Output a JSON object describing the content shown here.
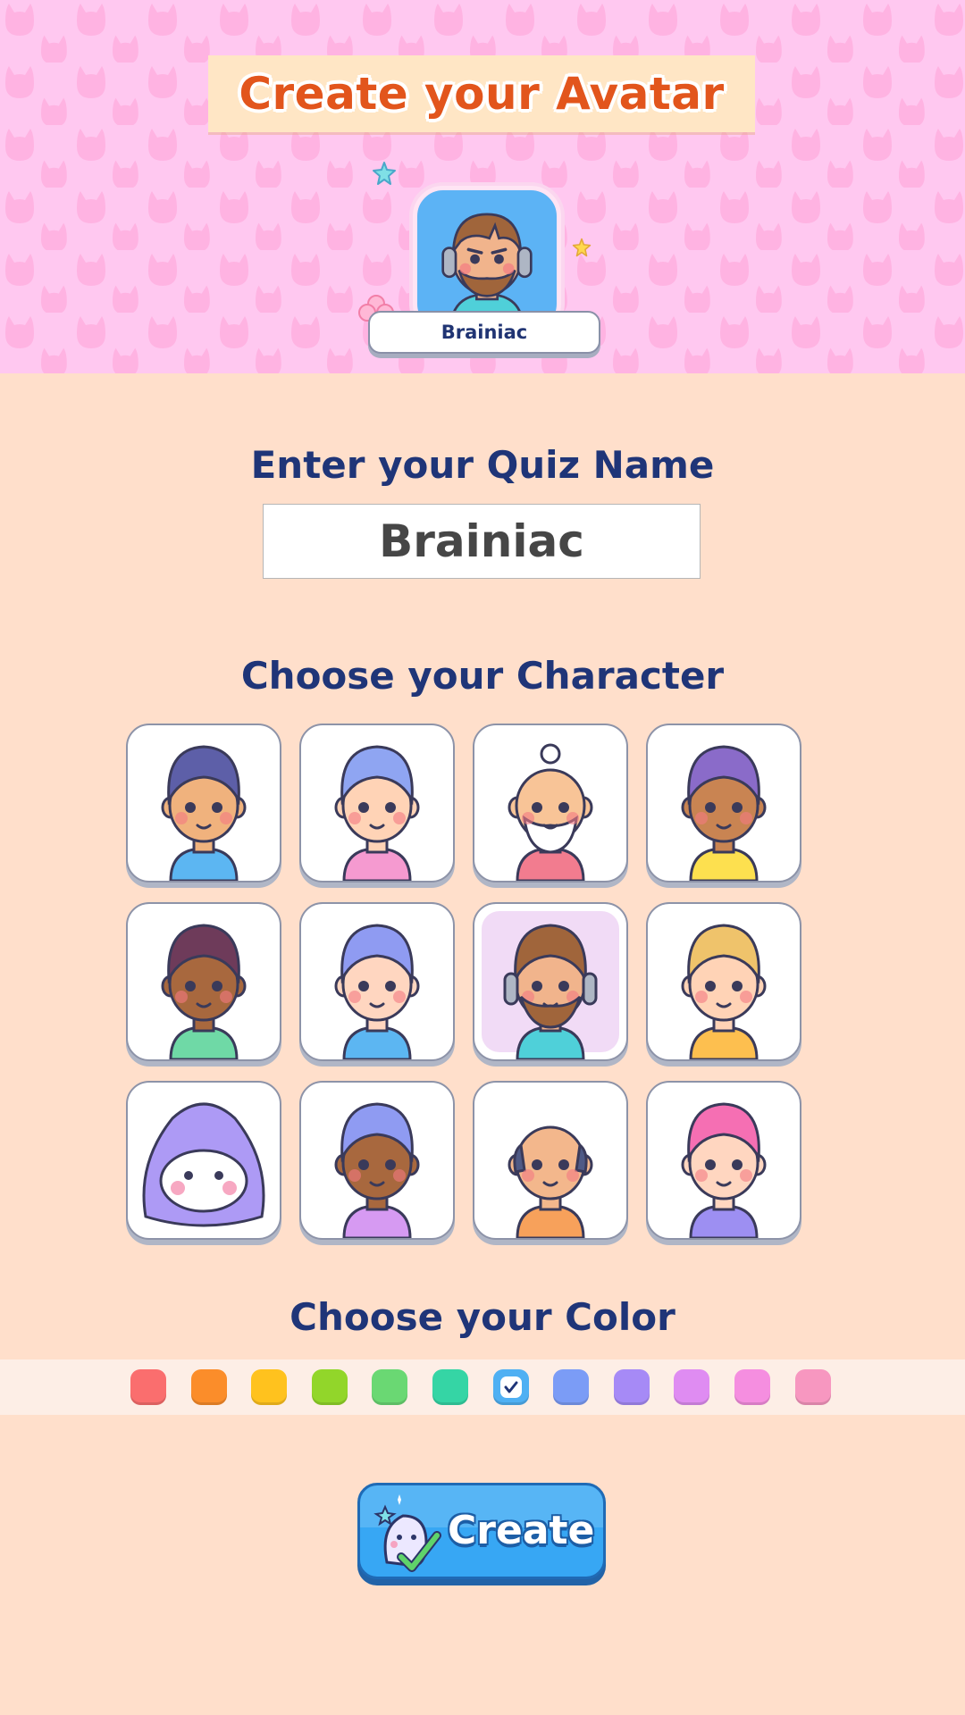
{
  "header": {
    "title": "Create your Avatar",
    "preview_name": "Brainiac",
    "background_color": "#ffc8f0"
  },
  "name_section": {
    "heading": "Enter your Quiz Name",
    "input_value": "Brainiac"
  },
  "character_section": {
    "heading": "Choose your Character",
    "characters": [
      {
        "name": "purple-hair-bearded-boy",
        "skin": "#f0b27d",
        "hair": "#5d5fa8",
        "shirt": "#5cb6f2"
      },
      {
        "name": "blue-pigtail-girl",
        "skin": "#ffd3b6",
        "hair": "#8fa5f2",
        "shirt": "#f59ad0"
      },
      {
        "name": "old-sage",
        "skin": "#f8c497",
        "hair": "#ffffff",
        "shirt": "#f27c8f"
      },
      {
        "name": "curly-glasses-boy",
        "skin": "#c98452",
        "hair": "#8a6bc9",
        "shirt": "#fde04f"
      },
      {
        "name": "bun-hair-girl",
        "skin": "#a8683e",
        "hair": "#6e3b5a",
        "shirt": "#6fd9a6"
      },
      {
        "name": "cloud-hat-girl",
        "skin": "#ffd6c0",
        "hair": "#8f9bf2",
        "shirt": "#5cb6f2"
      },
      {
        "name": "headphone-bearded-man",
        "skin": "#f1b48c",
        "hair": "#a0653b",
        "shirt": "#4fd0d9"
      },
      {
        "name": "blonde-curly-boy",
        "skin": "#ffd3b6",
        "hair": "#efc36b",
        "shirt": "#fdbf4f"
      },
      {
        "name": "ghost-hood",
        "skin": "#ffffff",
        "hair": "#ad9af5",
        "shirt": "#ad9af5"
      },
      {
        "name": "half-robot-girl",
        "skin": "#a8683e",
        "hair": "#8f9bf2",
        "shirt": "#d69af2"
      },
      {
        "name": "bald-grandpa",
        "skin": "#f3b78c",
        "hair": "#4f5a86",
        "shirt": "#f7a15b"
      },
      {
        "name": "pink-bunny-girl",
        "skin": "#ffd6c0",
        "hair": "#f56fb3",
        "shirt": "#9d8ff2"
      }
    ],
    "selected_index": 6
  },
  "color_section": {
    "heading": "Choose your Color",
    "colors": [
      "#fa6e6e",
      "#fb8d2a",
      "#ffc21e",
      "#92d62a",
      "#6ad873",
      "#35d5a5",
      "#4fb0f3",
      "#7b9cf6",
      "#a68af6",
      "#df8cf2",
      "#f58ee0",
      "#f797c0"
    ],
    "selected_index": 6
  },
  "create_button": {
    "label": "Create"
  }
}
